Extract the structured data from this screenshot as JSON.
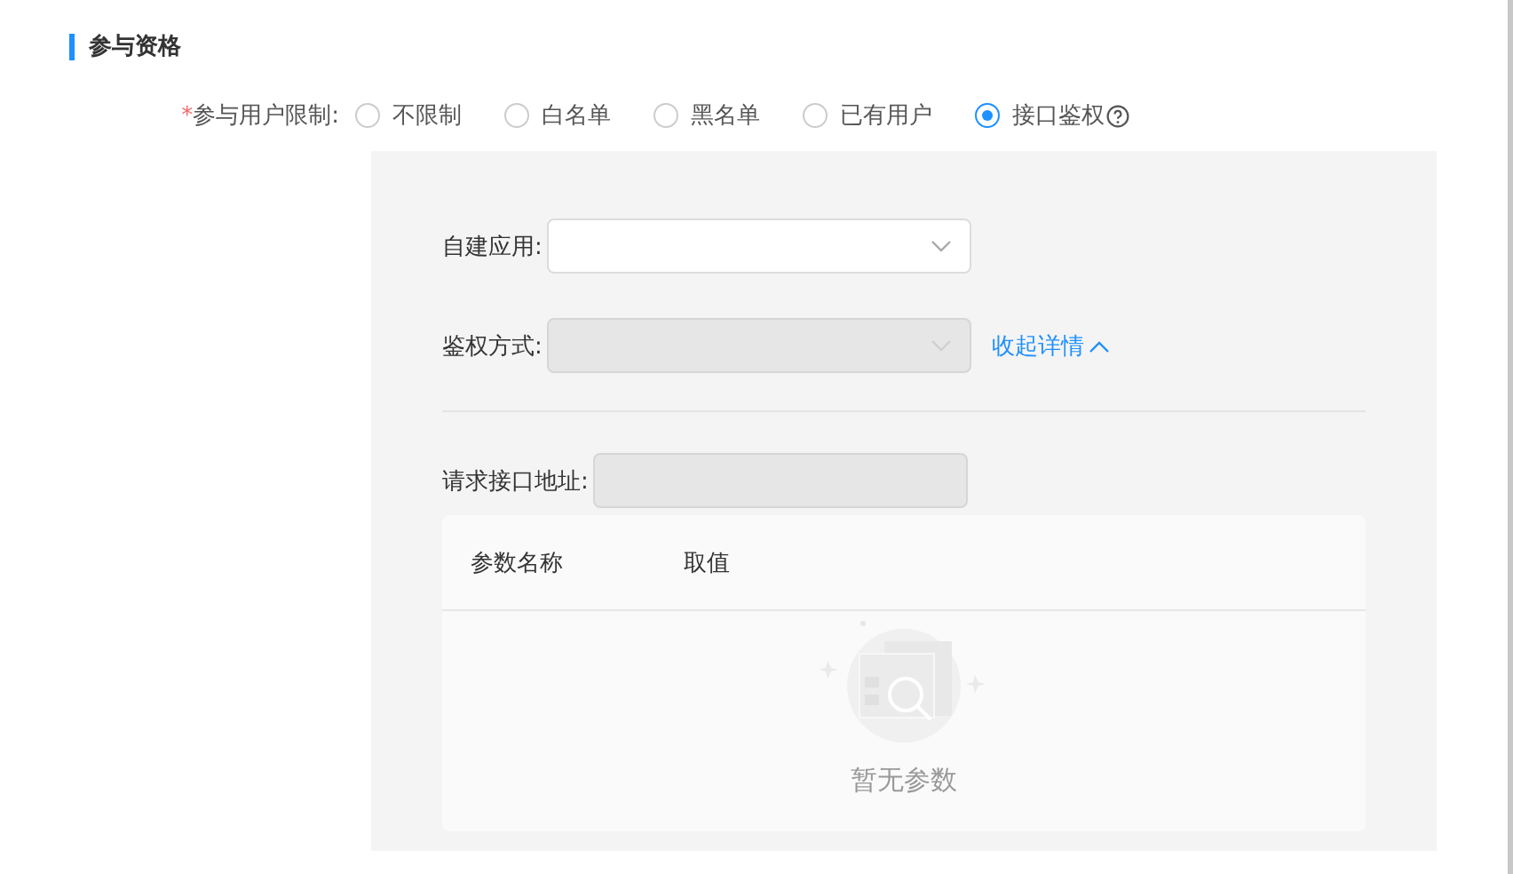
{
  "section": {
    "title": "参与资格"
  },
  "limit": {
    "required_mark": "*",
    "label": "参与用户限制:",
    "options": [
      {
        "label": "不限制",
        "selected": false,
        "help": false
      },
      {
        "label": "白名单",
        "selected": false,
        "help": false
      },
      {
        "label": "黑名单",
        "selected": false,
        "help": false
      },
      {
        "label": "已有用户",
        "selected": false,
        "help": false
      },
      {
        "label": "接口鉴权",
        "selected": true,
        "help": true
      }
    ]
  },
  "auth_form": {
    "fields": [
      {
        "kind": "select",
        "label": "自建应用:",
        "disabled": false
      },
      {
        "kind": "select",
        "label": "鉴权方式:",
        "disabled": true,
        "link": "收起详情"
      },
      {
        "kind": "divider"
      },
      {
        "kind": "input",
        "label": "请求接口地址:",
        "disabled": true
      }
    ],
    "params_table": {
      "columns": [
        "参数名称",
        "取值"
      ],
      "empty_text": "暂无参数"
    }
  }
}
